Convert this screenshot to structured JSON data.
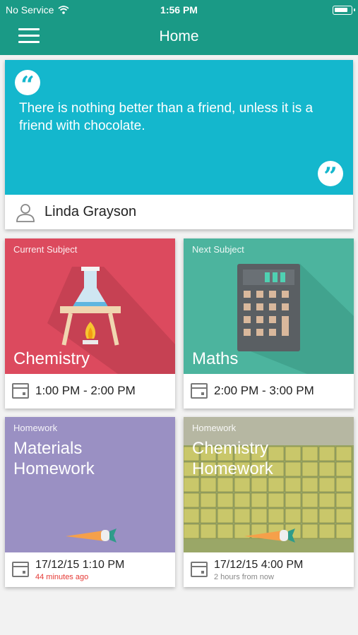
{
  "status_bar": {
    "carrier": "No Service",
    "time": "1:56 PM"
  },
  "header": {
    "title": "Home"
  },
  "quote": {
    "text": "There is nothing better than a friend, unless it is a friend with chocolate.",
    "author": "Linda Grayson"
  },
  "cards": [
    {
      "caption": "Current Subject",
      "title": "Chemistry",
      "time": "1:00 PM - 2:00 PM"
    },
    {
      "caption": "Next Subject",
      "title": "Maths",
      "time": "2:00 PM - 3:00 PM"
    },
    {
      "caption": "Homework",
      "title_line1": "Materials",
      "title_line2": "Homework",
      "date": "17/12/15 1:10 PM",
      "relative": "44 minutes ago"
    },
    {
      "caption": "Homework",
      "title_line1": "Chemistry",
      "title_line2": "Homework",
      "date": "17/12/15 4:00 PM",
      "relative": "2 hours from now"
    }
  ],
  "colors": {
    "header": "#1a9a86",
    "quote": "#14b7cd",
    "chemistry": "#dc4a5e",
    "maths": "#4cb49e",
    "materials": "#9a90c3",
    "overdue": "#e53935"
  },
  "icons": [
    "menu-icon",
    "wifi-icon",
    "battery-icon",
    "quote-icon",
    "person-icon",
    "flask-icon",
    "calculator-icon",
    "calendar-icon",
    "carrot-icon"
  ]
}
